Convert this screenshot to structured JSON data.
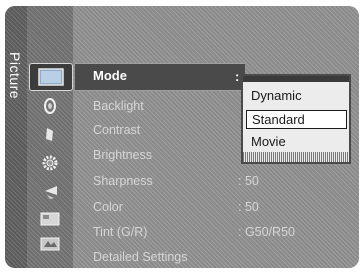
{
  "menu": {
    "category_label": "Picture",
    "categories": [
      {
        "icon": "picture-icon",
        "active": true
      },
      {
        "icon": "sound-icon"
      },
      {
        "icon": "channel-icon"
      },
      {
        "icon": "setup-icon"
      },
      {
        "icon": "input-icon"
      },
      {
        "icon": "application-icon"
      },
      {
        "icon": "support-icon"
      }
    ],
    "items": [
      {
        "label": "Mode",
        "value": ":"
      },
      {
        "label": "Backlight",
        "value": ""
      },
      {
        "label": "Contrast",
        "value": ""
      },
      {
        "label": "Brightness",
        "value": ""
      },
      {
        "label": "Sharpness",
        "value": ": 50"
      },
      {
        "label": "Color",
        "value": ": 50"
      },
      {
        "label": "Tint (G/R)",
        "value": ": G50/R50"
      },
      {
        "label": "Detailed Settings",
        "value": ""
      }
    ]
  },
  "mode_dropdown": {
    "options": [
      "Dynamic",
      "Standard",
      "Movie"
    ],
    "selected": "Standard"
  },
  "colors": {
    "menu_bg": "#8a8a8a",
    "highlight": "#4a4a4a",
    "dropdown_bg": "#ececec"
  }
}
